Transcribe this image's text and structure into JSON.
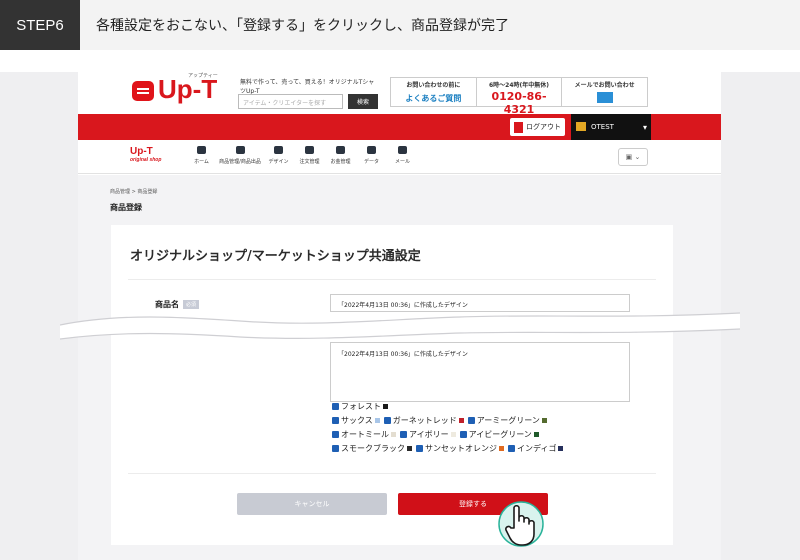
{
  "step": {
    "badge": "STEP6",
    "text": "各種設定をおこない、「登録する」をクリックし、商品登録が完了"
  },
  "site": {
    "logo": "Up-T",
    "logo_small": "アップティー",
    "tagline": "無料で作って、売って、買える！オリジナルTシャツUp-T",
    "search_placeholder": "アイテム・クリエイターを探す",
    "search_button": "検索",
    "contact": {
      "faq_head": "お問い合わせの前に",
      "faq_body": "よくあるご質問",
      "phone_head": "6時〜24時(年中無休)",
      "phone_body": "0120-86-4321",
      "mail_head": "メールでお問い合わせ"
    },
    "logout": "ログアウト",
    "user": "OTEST",
    "nav_logo": "Up-T",
    "nav_logo_sub": "original shop",
    "nav": [
      "ホーム",
      "商品管理/商品出品",
      "デザイン",
      "注文管理",
      "お金管理",
      "データ",
      "メール"
    ]
  },
  "page": {
    "breadcrumb": "商品管理 > 商品登録",
    "title": "商品登録",
    "card_title": "オリジナルショップ/マーケットショップ共通設定",
    "product_name_label": "商品名",
    "required_badge": "必須",
    "product_name_value": "「2022年4月13日 00:36」に作成したデザイン",
    "description_value": "「2022年4月13日 00:36」に作成したデザイン",
    "colors": [
      [
        {
          "name": "フォレスト",
          "color": "#1a1a1a"
        }
      ],
      [
        {
          "name": "サックス",
          "color": "#a9c6e8"
        },
        {
          "name": "ガーネットレッド",
          "color": "#c0202a"
        },
        {
          "name": "アーミーグリーン",
          "color": "#556b2f"
        }
      ],
      [
        {
          "name": "オートミール",
          "color": "#e3ddd0"
        },
        {
          "name": "アイボリー",
          "color": "#eeeadf"
        },
        {
          "name": "アイビーグリーン",
          "color": "#1f5a2a"
        }
      ],
      [
        {
          "name": "スモークブラック",
          "color": "#2a2a2a"
        },
        {
          "name": "サンセットオレンジ",
          "color": "#e06a20"
        },
        {
          "name": "インディゴ",
          "color": "#26305c"
        }
      ]
    ],
    "cancel": "キャンセル",
    "submit": "登録する"
  }
}
